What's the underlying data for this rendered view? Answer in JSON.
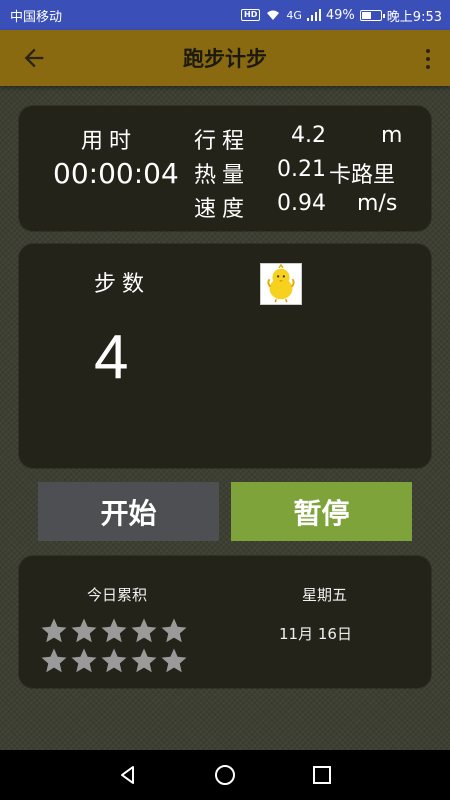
{
  "status_bar": {
    "carrier": "中国移动",
    "hd": "HD",
    "network": "4G",
    "battery_percent": "49%",
    "time": "晚上9:53",
    "background": "#3b4fb8"
  },
  "app_bar": {
    "title": "跑步计步",
    "background": "#8a6a10",
    "back_icon": "arrow-left-icon",
    "menu_icon": "more-vertical-icon"
  },
  "stats": {
    "time_label": "用时",
    "time_value": "00:00:04",
    "distance_label": "行程",
    "distance_value": "4.2",
    "distance_unit": "m",
    "calories_label": "热量",
    "calories_value": "0.21",
    "calories_unit": "卡路里",
    "speed_label": "速度",
    "speed_value": "0.94",
    "speed_unit": "m/s"
  },
  "steps": {
    "label": "步数",
    "value": "4",
    "avatar_icon": "chick-icon"
  },
  "buttons": {
    "start": "开始",
    "pause": "暂停",
    "pause_color": "#7ea33b",
    "start_color": "#4e4f52"
  },
  "today": {
    "title": "今日累积",
    "weekday": "星期五",
    "date": "11月 16日",
    "stars_total": 10,
    "stars_filled": 0,
    "star_icon": "star-icon"
  },
  "nav_bar": {
    "back_icon": "triangle-back-icon",
    "home_icon": "circle-home-icon",
    "recent_icon": "square-recent-icon"
  }
}
